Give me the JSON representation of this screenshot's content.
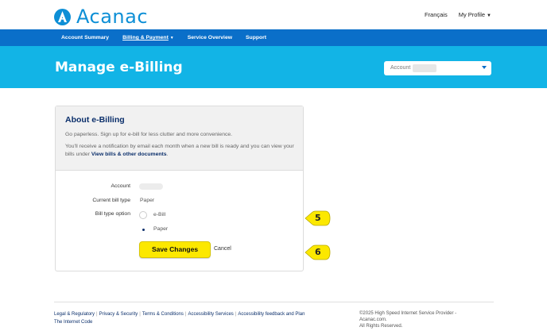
{
  "brand": {
    "name": "Acanac",
    "color": "#0d8fd6"
  },
  "top_links": {
    "language": "Français",
    "profile": "My Profile"
  },
  "nav": [
    {
      "label": "Account Summary"
    },
    {
      "label": "Billing & Payment"
    },
    {
      "label": "Service Overview"
    },
    {
      "label": "Support"
    }
  ],
  "banner": {
    "title": "Manage e-Billing",
    "account_label": "Account"
  },
  "card": {
    "title": "About e-Billing",
    "intro": "Go paperless. Sign up for e-bill for less clutter and more convenience.",
    "notice_pre": "You'll receive a notification by email each month when a new bill is ready and you can view your bills under ",
    "notice_link": "View bills & other documents",
    "notice_post": ".",
    "account_label": "Account",
    "current_bill_label": "Current bill type",
    "current_bill_value": "Paper",
    "option_label": "Bill type option",
    "options": [
      {
        "label": "e-Bill",
        "selected": false
      },
      {
        "label": "Paper",
        "selected": true
      }
    ],
    "save_label": "Save Changes",
    "cancel_label": "Cancel"
  },
  "callouts": {
    "a": "5",
    "b": "6"
  },
  "footer": {
    "links": [
      "Legal & Regulatory",
      "Privacy & Security",
      "Terms & Conditions",
      "Accessibility Services",
      "Accessibility feedback and Plan",
      "The Internet Code"
    ],
    "copyright_1": "©2025 High Speed Internet Service Provider -",
    "copyright_2": "Acanac.com.",
    "copyright_3": "All Rights Reserved."
  },
  "colors": {
    "nav": "#0a6fc9",
    "banner": "#12b4e6",
    "button": "#fce800",
    "title": "#0b2f6b"
  }
}
